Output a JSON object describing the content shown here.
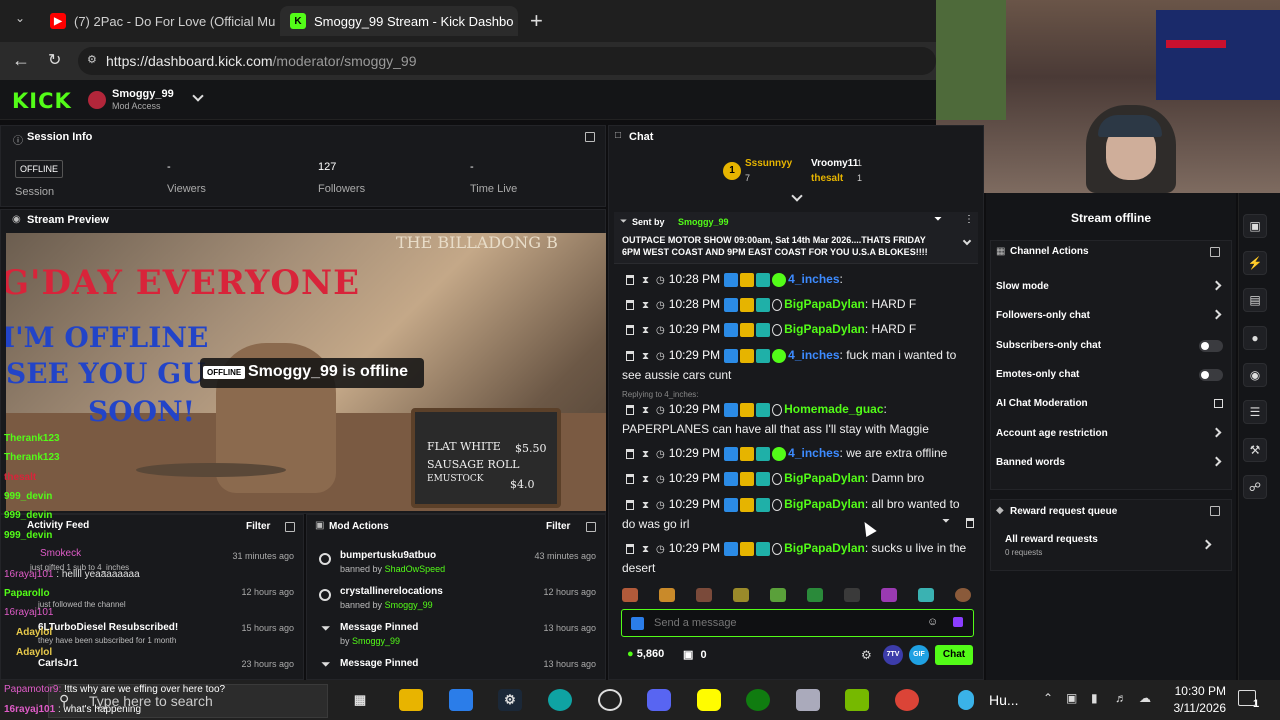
{
  "browser": {
    "tabs": [
      {
        "title": "(7) 2Pac - Do For Love (Official Mu",
        "active": false
      },
      {
        "title": "Smoggy_99 Stream - Kick Dashbo",
        "active": true
      }
    ],
    "url_host": "https://dashboard.kick.com",
    "url_path": "/moderator/smoggy_99"
  },
  "header": {
    "logo": "KICK",
    "channel_name": "Smoggy_99",
    "channel_sub": "Mod Access"
  },
  "session_info": {
    "title": "Session Info",
    "status_badge": "OFFLINE",
    "stats": [
      {
        "value": "",
        "label": "Session"
      },
      {
        "value": "-",
        "label": "Viewers"
      },
      {
        "value": "127",
        "label": "Followers"
      },
      {
        "value": "-",
        "label": "Time Live"
      }
    ]
  },
  "preview": {
    "title": "Stream Preview",
    "offline_badge": "OFFLINE",
    "offline_message": "Smoggy_99 is offline",
    "art_line1": "G'DAY EVERYONE",
    "art_line2": "I'M OFFLINE",
    "art_line3": "SEE YOU GU",
    "art_line4": "SOON!",
    "art_sign": "THE BILLADONG B",
    "board": {
      "l1": "FLAT WHITE",
      "p1": "$5.50",
      "l2": "SAUSAGE ROLL",
      "l3": "EMUSTOCK",
      "p3": "$4.0"
    }
  },
  "overlay_chat": [
    {
      "user": "Therank123",
      "text": ""
    },
    {
      "user": "Therank123",
      "text": ""
    },
    {
      "user": "thesalt",
      "text": ""
    },
    {
      "user": "999_devin",
      "text": ""
    },
    {
      "user": "999_devin",
      "text": ""
    },
    {
      "user": "999_devin",
      "text": ""
    },
    {
      "user": "Smokeck",
      "text": ""
    },
    {
      "user": "16rayaj101",
      "text": "hellll yeaaaaaaaa"
    },
    {
      "user": "Paparollo",
      "text": ""
    },
    {
      "user": "16rayaj101",
      "text": ""
    },
    {
      "user": "Adaylol",
      "text": ""
    },
    {
      "user": "Adaylol",
      "text": ""
    },
    {
      "user": "16rayaj101",
      "text": "what's happening"
    }
  ],
  "overlay_extra": {
    "l1": "just gifted 1 sub to 4_inches",
    "l2": "just followed the channel",
    "l3": "6LTurboDiesel Resubscribed!",
    "l4": "they have been subscribed for 1 month",
    "l5": "CarlsJr1",
    "l6": "!tts why are we effing over here too?"
  },
  "activity_feed": {
    "title": "Activity Feed",
    "filter": "Filter",
    "times": [
      "31 minutes ago",
      "12 hours ago",
      "15 hours ago",
      "23 hours ago"
    ]
  },
  "mod_actions": {
    "title": "Mod Actions",
    "filter": "Filter",
    "items": [
      {
        "title": "bumpertusku9atbuo",
        "sub_prefix": "banned by",
        "sub_user": "ShadOwSpeed",
        "time": "43 minutes ago"
      },
      {
        "title": "crystallinerelocations",
        "sub_prefix": "banned by",
        "sub_user": "Smoggy_99",
        "time": "12 hours ago"
      },
      {
        "title": "Message Pinned",
        "sub_prefix": "by",
        "sub_user": "Smoggy_99",
        "time": "13 hours ago"
      },
      {
        "title": "Message Pinned",
        "sub_prefix": "",
        "sub_user": "",
        "time": "13 hours ago"
      }
    ]
  },
  "chat": {
    "title": "Chat",
    "leaderboard": [
      {
        "rank": "1",
        "user": "Sssunnyy",
        "count": "7"
      },
      {
        "rank": "",
        "user": "Vroomy11",
        "count": "1"
      },
      {
        "rank": "",
        "user": "thesalt",
        "count": "1"
      }
    ],
    "pinned": {
      "sent_by": "Sent by",
      "user": "Smoggy_99",
      "text": "OUTPACE MOTOR SHOW 09:00am, Sat 14th Mar 2026....THATS FRIDAY 6PM WEST COAST AND 9PM EAST COAST FOR YOU U.S.A BLOKES!!!!"
    },
    "messages": [
      {
        "time": "10:28 PM",
        "user": "4_inches",
        "color": "blue",
        "text": ""
      },
      {
        "time": "10:28 PM",
        "user": "BigPapaDylan",
        "color": "green",
        "text": "HARD F"
      },
      {
        "time": "10:29 PM",
        "user": "BigPapaDylan",
        "color": "green",
        "text": "HARD F"
      },
      {
        "time": "10:29 PM",
        "user": "4_inches",
        "color": "blue",
        "text": "fuck man i wanted to see aussie cars cunt"
      },
      {
        "time": "10:29 PM",
        "user": "Homemade_guac",
        "color": "green",
        "text": "PAPERPLANES can have all that ass I'll stay with Maggie",
        "reply": "Replying to 4_inches:"
      },
      {
        "time": "10:29 PM",
        "user": "4_inches",
        "color": "blue",
        "text": "we are extra offline"
      },
      {
        "time": "10:29 PM",
        "user": "BigPapaDylan",
        "color": "green",
        "text": "Damn bro"
      },
      {
        "time": "10:29 PM",
        "user": "BigPapaDylan",
        "color": "green",
        "text": "all bro wanted to do was go irl"
      },
      {
        "time": "10:29 PM",
        "user": "BigPapaDylan",
        "color": "green",
        "text": "sucks u live in the desert"
      }
    ],
    "input_placeholder": "Send a message",
    "points": "5,860",
    "gifts": "0",
    "send_label": "Chat",
    "btn_7tv": "7TV",
    "btn_gif": "GIF"
  },
  "right": {
    "stream_status": "Stream offline",
    "channel_actions_title": "Channel Actions",
    "actions": [
      {
        "label": "Slow mode",
        "kind": "chevron"
      },
      {
        "label": "Followers-only chat",
        "kind": "chevron"
      },
      {
        "label": "Subscribers-only chat",
        "kind": "toggle"
      },
      {
        "label": "Emotes-only chat",
        "kind": "toggle"
      },
      {
        "label": "AI Chat Moderation",
        "kind": "external"
      },
      {
        "label": "Account age restriction",
        "kind": "chevron"
      },
      {
        "label": "Banned words",
        "kind": "chevron"
      }
    ],
    "reward_title": "Reward request queue",
    "reward_item": "All reward requests",
    "reward_count": "0 requests"
  },
  "taskbar": {
    "search_placeholder": "Type here to search",
    "weather": "Hu...",
    "time": "10:30 PM",
    "date": "3/11/2026",
    "notif": "1"
  },
  "colors": {
    "kick_green": "#53fc18",
    "panel": "#18191c",
    "bg": "#0e0e10",
    "blue_user": "#3d8bff"
  }
}
